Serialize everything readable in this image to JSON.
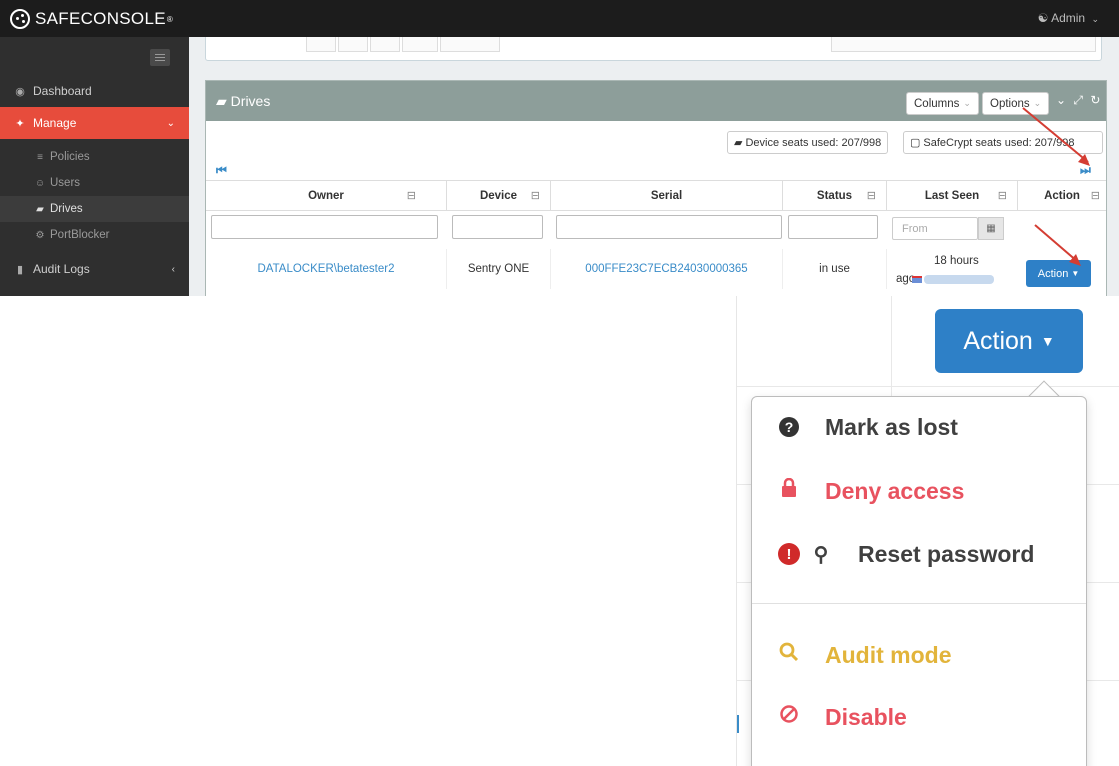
{
  "app": {
    "brand": "SAFECONSOLE",
    "brand_mark": "®",
    "user_menu": "Admin"
  },
  "sidebar": {
    "items": [
      {
        "label": "Dashboard",
        "icon": "dashboard-icon"
      },
      {
        "label": "Manage",
        "icon": "wrench-icon"
      },
      {
        "label": "Audit Logs",
        "icon": "book-icon"
      }
    ],
    "subitems": [
      {
        "label": "Policies",
        "icon": "sliders-icon"
      },
      {
        "label": "Users",
        "icon": "user-icon"
      },
      {
        "label": "Drives",
        "icon": "drive-icon"
      },
      {
        "label": "PortBlocker",
        "icon": "usb-icon"
      }
    ]
  },
  "panel": {
    "title": "Drives",
    "columns_btn": "Columns",
    "options_btn": "Options",
    "device_seats": "Device seats used: 207/998",
    "safecrypt_seats": "SafeCrypt seats used: 207/998"
  },
  "table": {
    "headers": [
      "Owner",
      "Device",
      "Serial",
      "Status",
      "Last Seen",
      "Action"
    ],
    "from_placeholder": "From",
    "row": {
      "owner": "DATALOCKER\\betatester2",
      "device": "Sentry ONE",
      "serial": "000FFE23C7ECB24030000365",
      "status": "in use",
      "last_seen_1": "18 hours",
      "last_seen_2": "ago",
      "action": "Action"
    }
  },
  "inset": {
    "action_label": "Action",
    "menu": [
      {
        "label": "Mark as lost",
        "icon": "question-circle-icon",
        "color": "#404040"
      },
      {
        "label": "Deny access",
        "icon": "lock-icon",
        "color": "#e8525f"
      },
      {
        "label": "Reset password",
        "icon": "key-icon",
        "color": "#404040"
      },
      {
        "label": "Audit mode",
        "icon": "search-icon",
        "color": "#e2b43b"
      },
      {
        "label": "Disable",
        "icon": "ban-icon",
        "color": "#e8525f"
      }
    ]
  },
  "colors": {
    "brand_red": "#e74c3c",
    "primary_blue": "#2e80c7",
    "panel_header": "#8d9e9a"
  }
}
